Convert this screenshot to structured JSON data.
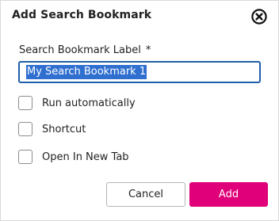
{
  "dialog": {
    "title": "Add Search Bookmark",
    "close_icon": "close-circle-icon"
  },
  "form": {
    "label": "Search Bookmark Label",
    "required_marker": "*",
    "input_value": "My Search Bookmark 1",
    "options": [
      {
        "label": "Run automatically",
        "checked": false
      },
      {
        "label": "Shortcut",
        "checked": false
      },
      {
        "label": "Open In New Tab",
        "checked": false
      }
    ]
  },
  "actions": {
    "cancel_label": "Cancel",
    "add_label": "Add"
  },
  "colors": {
    "accent": "#e0007a",
    "focus_border": "#1f5fa8",
    "selection": "#2f6fd0"
  }
}
